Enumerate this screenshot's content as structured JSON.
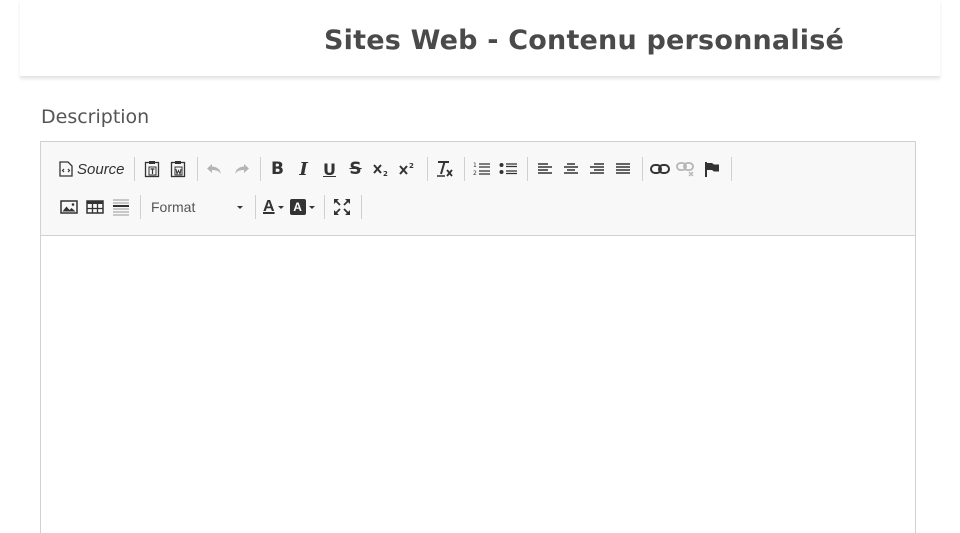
{
  "header": {
    "title": "Sites Web - Contenu personnalisé"
  },
  "form": {
    "description_label": "Description"
  },
  "editor": {
    "toolbar": {
      "source_label": "Source",
      "format_label": "Format"
    },
    "content": ""
  },
  "icons": [
    "source-icon",
    "paste-text-icon",
    "paste-word-icon",
    "undo-icon",
    "redo-icon",
    "bold-icon",
    "italic-icon",
    "underline-icon",
    "strikethrough-icon",
    "subscript-icon",
    "superscript-icon",
    "remove-format-icon",
    "numbered-list-icon",
    "bulleted-list-icon",
    "align-left-icon",
    "align-center-icon",
    "align-right-icon",
    "justify-icon",
    "link-icon",
    "unlink-icon",
    "anchor-icon",
    "image-icon",
    "table-icon",
    "horizontal-rule-icon",
    "text-color-icon",
    "background-color-icon",
    "maximize-icon"
  ],
  "colors": {
    "title": "#4a4a4a",
    "toolbar_bg": "#f8f8f8",
    "border": "#d1d1d1"
  }
}
